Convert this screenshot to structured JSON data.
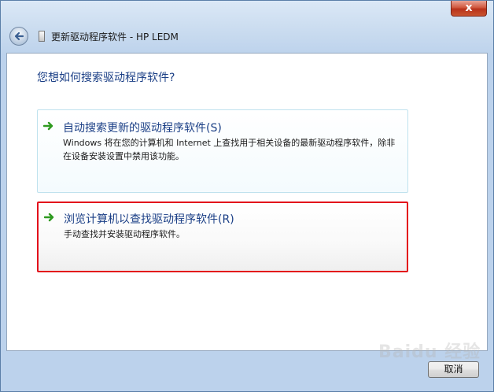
{
  "window": {
    "title": "更新驱动程序软件 - HP LEDM",
    "close_glyph": "x"
  },
  "main": {
    "heading": "您想如何搜索驱动程序软件?",
    "options": [
      {
        "title": "自动搜索更新的驱动程序软件(S)",
        "description": "Windows 将在您的计算机和 Internet 上查找用于相关设备的最新驱动程序软件，除非在设备安装设置中禁用该功能。"
      },
      {
        "title": "浏览计算机以查找驱动程序软件(R)",
        "description": "手动查找并安装驱动程序软件。"
      }
    ]
  },
  "footer": {
    "cancel_label": "取消"
  },
  "watermark": "Baidu 经验",
  "colors": {
    "accent_text": "#1b3f86",
    "arrow_green": "#2f9a20",
    "highlight_red": "#e3101b"
  }
}
